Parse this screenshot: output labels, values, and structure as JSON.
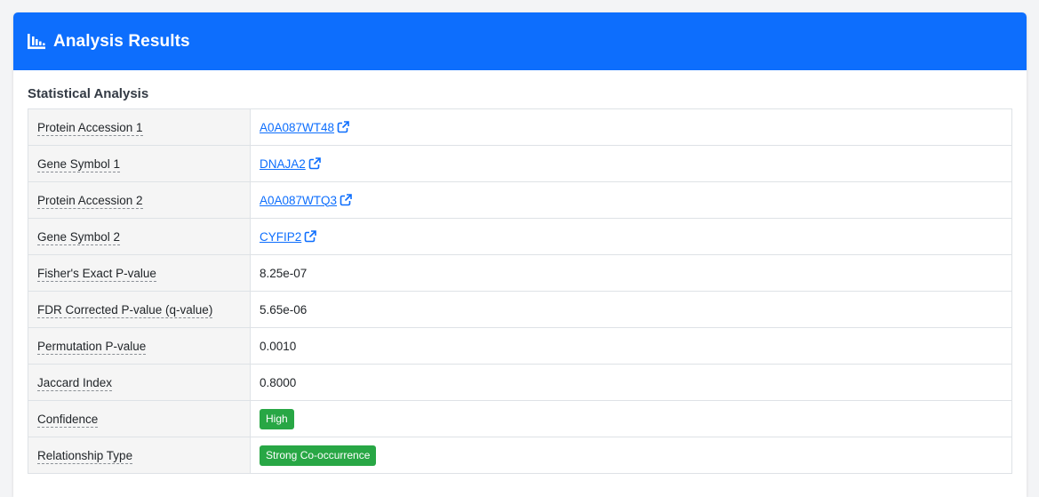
{
  "header": {
    "title": "Analysis Results",
    "icon": "chart-bar-icon",
    "color": "#0d6efd"
  },
  "section": {
    "title": "Statistical Analysis"
  },
  "rows": [
    {
      "label": "Protein Accession 1",
      "value": "A0A087WT48",
      "type": "link"
    },
    {
      "label": "Gene Symbol 1",
      "value": "DNAJA2",
      "type": "link"
    },
    {
      "label": "Protein Accession 2",
      "value": "A0A087WTQ3",
      "type": "link"
    },
    {
      "label": "Gene Symbol 2",
      "value": "CYFIP2",
      "type": "link"
    },
    {
      "label": "Fisher's Exact P-value",
      "value": "8.25e-07",
      "type": "text"
    },
    {
      "label": "FDR Corrected P-value (q-value)",
      "value": "5.65e-06",
      "type": "text"
    },
    {
      "label": "Permutation P-value",
      "value": "0.0010",
      "type": "text"
    },
    {
      "label": "Jaccard Index",
      "value": "0.8000",
      "type": "text"
    },
    {
      "label": "Confidence",
      "value": "High",
      "type": "badge"
    },
    {
      "label": "Relationship Type",
      "value": "Strong Co-occurrence",
      "type": "badge"
    }
  ],
  "colors": {
    "link": "#0d6efd",
    "badge_success": "#28a745"
  }
}
